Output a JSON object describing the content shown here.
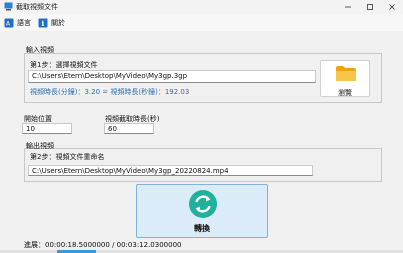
{
  "window": {
    "title": "截取視頻文件",
    "colors": {
      "accent": "#3a9bdc",
      "info_text": "#2b6fb6",
      "convert_bg": "#dcebf8",
      "convert_border": "#7fb2dc"
    }
  },
  "menu": {
    "items": [
      {
        "label": "語言",
        "icon": "language-icon"
      },
      {
        "label": "關於",
        "icon": "info-icon"
      }
    ]
  },
  "input_group": {
    "label": "輸入視頻",
    "step_label": "第1步：選擇視頻文件",
    "file_path": "C:\\Users\\Etern\\Desktop\\MyVideo\\My3gp.3gp",
    "info": "視頻時長(分鐘)：3.20 = 視頻時長(秒鐘)：192.03",
    "browse_label": "瀏覽",
    "browse_icon": "folder-icon"
  },
  "params": {
    "start_label": "開始位置",
    "start_value": "10",
    "duration_label": "視頻截取時長(秒)",
    "duration_value": "60"
  },
  "output_group": {
    "label": "輸出視頻",
    "step_label": "第2步：視頻文件重命名",
    "file_path": "C:\\Users\\Etern\\Desktop\\MyVideo\\My3gp_20220824.mp4"
  },
  "convert": {
    "label": "轉換",
    "icon": "refresh-icon"
  },
  "status": {
    "text": "進展：00:00:18.5000000 / 00:03:12.0300000",
    "progress_fraction": 0.096
  }
}
